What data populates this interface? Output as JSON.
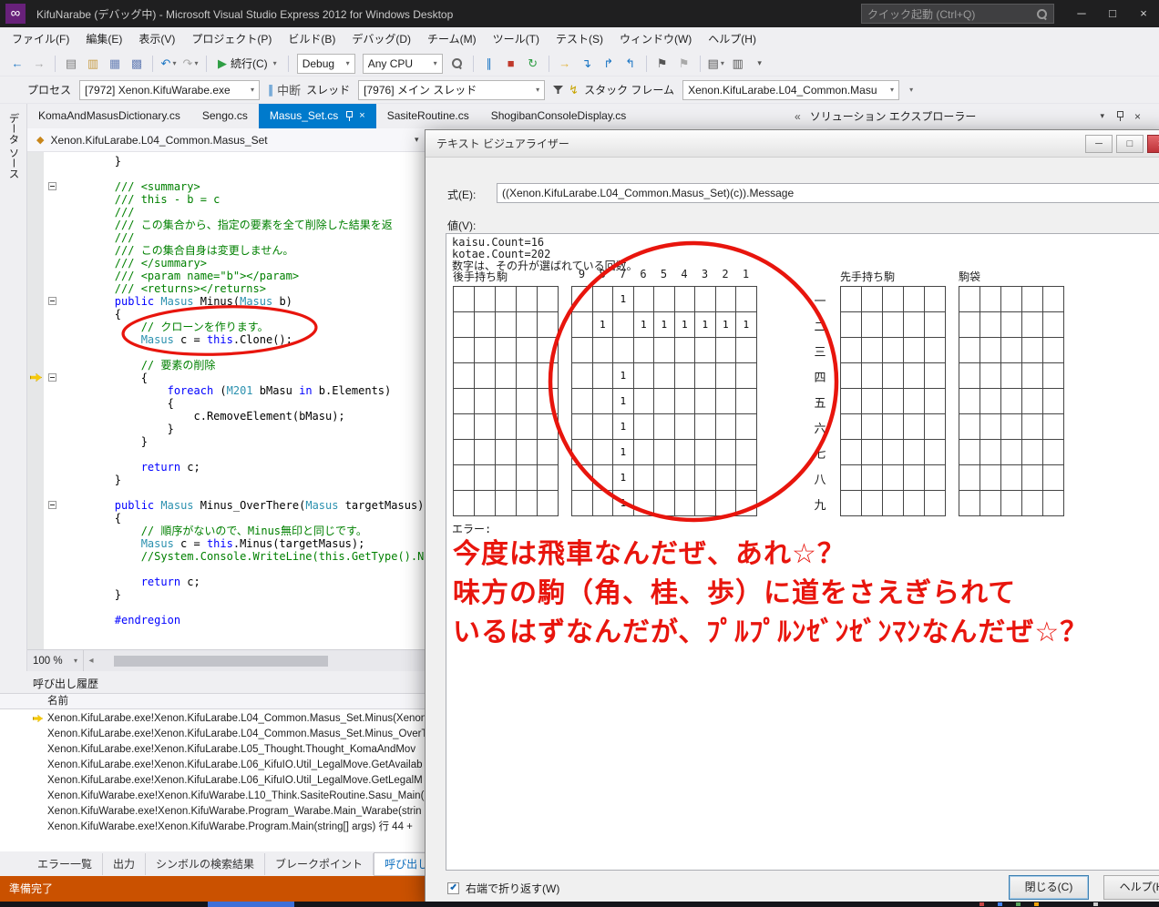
{
  "window": {
    "title": "KifuNarabe (デバッグ中) - Microsoft Visual Studio Express 2012 for Windows Desktop",
    "quick_launch": "クイック起動 (Ctrl+Q)",
    "buttons": [
      {
        "name": "minimize-button",
        "glyph": "─"
      },
      {
        "name": "maximize-button",
        "glyph": "□"
      },
      {
        "name": "close-button",
        "glyph": "×"
      }
    ]
  },
  "icons": {
    "dropdown": "▾",
    "close": "×",
    "chevrons_left": "«",
    "scroll_left": "◂",
    "breadcrumb_class": "◆",
    "stack_frame": "↯",
    "break_all": "∥"
  },
  "menu": {
    "items": [
      "ファイル(F)",
      "編集(E)",
      "表示(V)",
      "プロジェクト(P)",
      "ビルド(B)",
      "デバッグ(D)",
      "チーム(M)",
      "ツール(T)",
      "テスト(S)",
      "ウィンドウ(W)",
      "ヘルプ(H)"
    ]
  },
  "toolbar": {
    "items": [
      {
        "t": "icon",
        "name": "navigate-back-icon",
        "g": "←",
        "c": "#1c76c4"
      },
      {
        "t": "icon",
        "name": "navigate-forward-icon",
        "g": "→",
        "c": "#a9a9a9"
      },
      {
        "t": "sep"
      },
      {
        "t": "icon",
        "name": "new-file-icon",
        "g": "▤",
        "c": "#7d7d7d"
      },
      {
        "t": "icon",
        "name": "open-file-icon",
        "g": "▥",
        "c": "#c79d46"
      },
      {
        "t": "icon",
        "name": "save-icon",
        "g": "▦",
        "c": "#6b83b7"
      },
      {
        "t": "icon",
        "name": "save-all-icon",
        "g": "▩",
        "c": "#6b83b7"
      },
      {
        "t": "sep"
      },
      {
        "t": "icon",
        "name": "undo-icon",
        "g": "↶",
        "c": "#1c76c4",
        "dd": true
      },
      {
        "t": "icon",
        "name": "redo-icon",
        "g": "↷",
        "c": "#a9a9a9",
        "dd": true
      },
      {
        "t": "sep"
      },
      {
        "t": "continue",
        "name": "continue-button",
        "g": "▶",
        "c": "#2f9e44",
        "label": "続行(C)",
        "dd": true
      },
      {
        "t": "sep"
      },
      {
        "t": "combo",
        "name": "solution-configurations-combo",
        "v": "Debug",
        "w": 64
      },
      {
        "t": "combo",
        "name": "solution-platforms-combo",
        "v": "Any CPU",
        "w": 88
      },
      {
        "t": "magnifier",
        "name": "find-icon"
      },
      {
        "t": "sep"
      },
      {
        "t": "icon",
        "name": "break-all-icon",
        "g": "∥",
        "c": "#1c76c4"
      },
      {
        "t": "icon",
        "name": "stop-debugging-icon",
        "g": "■",
        "c": "#c0392b"
      },
      {
        "t": "icon",
        "name": "restart-icon",
        "g": "↻",
        "c": "#2f9e44"
      },
      {
        "t": "sep"
      },
      {
        "t": "icon",
        "name": "show-next-statement-icon",
        "g": "→",
        "c": "#e0b23a"
      },
      {
        "t": "icon",
        "name": "step-into-icon",
        "g": "↴",
        "c": "#1c76c4"
      },
      {
        "t": "icon",
        "name": "step-over-icon",
        "g": "↱",
        "c": "#1c76c4"
      },
      {
        "t": "icon",
        "name": "step-out-icon",
        "g": "↰",
        "c": "#1c76c4"
      },
      {
        "t": "sep"
      },
      {
        "t": "icon",
        "name": "bookmark-icon",
        "g": "⚑",
        "c": "#555555"
      },
      {
        "t": "icon",
        "name": "bookmark-next-icon",
        "g": "⚑",
        "c": "#a9a9a9"
      },
      {
        "t": "sep"
      },
      {
        "t": "icon",
        "name": "output-window-icon",
        "g": "▤",
        "c": "#555555",
        "dd": true
      },
      {
        "t": "icon",
        "name": "immediate-window-icon",
        "g": "▥",
        "c": "#555555"
      },
      {
        "t": "dd",
        "name": "toolbar-options-icon"
      }
    ]
  },
  "debug_bar": {
    "process_label": "プロセス",
    "process_value": "[7972] Xenon.KifuWarabe.exe",
    "break_label": "中断",
    "thread_label": "スレッド",
    "thread_value": "[7976] メイン スレッド",
    "stack_frame_label": "スタック フレーム",
    "stack_frame_value": "Xenon.KifuLarabe.L04_Common.Masu"
  },
  "doc_tabs": [
    {
      "label": "KomaAndMasusDictionary.cs",
      "active": false
    },
    {
      "label": "Sengo.cs",
      "active": false
    },
    {
      "label": "Masus_Set.cs",
      "active": true
    },
    {
      "label": "SasiteRoutine.cs",
      "active": false
    },
    {
      "label": "ShogibanConsoleDisplay.cs",
      "active": false
    }
  ],
  "solution_explorer": {
    "collapse_icon": "«",
    "title": "ソリューション エクスプローラー"
  },
  "data_sources_tab": "データ ソース",
  "editor": {
    "breadcrumb": "Xenon.KifuLarabe.L04_Common.Masus_Set",
    "zoom": "100 %",
    "lines": [
      {
        "s": [
          [
            "pl",
            "        }"
          ]
        ]
      },
      {
        "s": []
      },
      {
        "s": [
          [
            "cm",
            "        /// <summary>"
          ]
        ],
        "fold": true
      },
      {
        "s": [
          [
            "cm",
            "        /// this - b = c"
          ]
        ]
      },
      {
        "s": [
          [
            "cm",
            "        ///"
          ]
        ]
      },
      {
        "s": [
          [
            "cm",
            "        /// この集合から、指定の要素を全て削除した結果を返"
          ]
        ]
      },
      {
        "s": [
          [
            "cm",
            "        ///"
          ]
        ]
      },
      {
        "s": [
          [
            "cm",
            "        /// この集合自身は変更しません。"
          ]
        ]
      },
      {
        "s": [
          [
            "cm",
            "        /// </summary>"
          ]
        ]
      },
      {
        "s": [
          [
            "cm",
            "        /// <param name=\"b\"></param>"
          ]
        ]
      },
      {
        "s": [
          [
            "cm",
            "        /// <returns></returns>"
          ]
        ]
      },
      {
        "s": [
          [
            "pl",
            "        "
          ],
          [
            "kw",
            "public"
          ],
          [
            "pl",
            " "
          ],
          [
            "ty",
            "Masus"
          ],
          [
            "pl",
            " Minus("
          ],
          [
            "ty",
            "Masus"
          ],
          [
            "pl",
            " b)"
          ]
        ],
        "fold": true
      },
      {
        "s": [
          [
            "pl",
            "        {"
          ]
        ]
      },
      {
        "s": [
          [
            "cm",
            "            // クローンを作ります。"
          ]
        ]
      },
      {
        "s": [
          [
            "pl",
            "            "
          ],
          [
            "ty",
            "Masus"
          ],
          [
            "pl",
            " c = "
          ],
          [
            "kw",
            "this"
          ],
          [
            "pl",
            ".Clone();"
          ]
        ]
      },
      {
        "s": []
      },
      {
        "s": [
          [
            "cm",
            "            // 要素の削除"
          ]
        ]
      },
      {
        "s": [
          [
            "pl",
            "            {"
          ]
        ],
        "fold": true,
        "arrow": true
      },
      {
        "s": [
          [
            "pl",
            "                "
          ],
          [
            "kw",
            "foreach"
          ],
          [
            "pl",
            " ("
          ],
          [
            "ty",
            "M201"
          ],
          [
            "pl",
            " bMasu "
          ],
          [
            "kw",
            "in"
          ],
          [
            "pl",
            " b.Elements)"
          ]
        ]
      },
      {
        "s": [
          [
            "pl",
            "                {"
          ]
        ]
      },
      {
        "s": [
          [
            "pl",
            "                    c.RemoveElement(bMasu);"
          ]
        ]
      },
      {
        "s": [
          [
            "pl",
            "                }"
          ]
        ]
      },
      {
        "s": [
          [
            "pl",
            "            }"
          ]
        ]
      },
      {
        "s": []
      },
      {
        "s": [
          [
            "pl",
            "            "
          ],
          [
            "kw",
            "return"
          ],
          [
            "pl",
            " c;"
          ]
        ]
      },
      {
        "s": [
          [
            "pl",
            "        }"
          ]
        ]
      },
      {
        "s": []
      },
      {
        "s": [
          [
            "pl",
            "        "
          ],
          [
            "kw",
            "public"
          ],
          [
            "pl",
            " "
          ],
          [
            "ty",
            "Masus"
          ],
          [
            "pl",
            " Minus_OverThere("
          ],
          [
            "ty",
            "Masus"
          ],
          [
            "pl",
            " targetMasus)"
          ]
        ],
        "fold": true
      },
      {
        "s": [
          [
            "pl",
            "        {"
          ]
        ]
      },
      {
        "s": [
          [
            "cm",
            "            // 順序がないので、Minus無印と同じです。"
          ]
        ]
      },
      {
        "s": [
          [
            "pl",
            "            "
          ],
          [
            "ty",
            "Masus"
          ],
          [
            "pl",
            " c = "
          ],
          [
            "kw",
            "this"
          ],
          [
            "pl",
            ".Minus(targetMasus);"
          ]
        ]
      },
      {
        "s": [
          [
            "cm",
            "            //System.Console.WriteLine(this.GetType().Nam"
          ]
        ]
      },
      {
        "s": []
      },
      {
        "s": [
          [
            "pl",
            "            "
          ],
          [
            "kw",
            "return"
          ],
          [
            "pl",
            " c;"
          ]
        ]
      },
      {
        "s": [
          [
            "pl",
            "        }"
          ]
        ]
      },
      {
        "s": []
      },
      {
        "s": [
          [
            "kw",
            "        #endregion"
          ]
        ]
      }
    ]
  },
  "call_stack": {
    "title": "呼び出し履歴",
    "column": "名前",
    "current_index": 0,
    "rows": [
      "Xenon.KifuLarabe.exe!Xenon.KifuLarabe.L04_Common.Masus_Set.Minus(Xenon",
      "Xenon.KifuLarabe.exe!Xenon.KifuLarabe.L04_Common.Masus_Set.Minus_OverT",
      "Xenon.KifuLarabe.exe!Xenon.KifuLarabe.L05_Thought.Thought_KomaAndMov",
      "Xenon.KifuLarabe.exe!Xenon.KifuLarabe.L06_KifuIO.Util_LegalMove.GetAvailab",
      "Xenon.KifuLarabe.exe!Xenon.KifuLarabe.L06_KifuIO.Util_LegalMove.GetLegalM",
      "Xenon.KifuWarabe.exe!Xenon.KifuWarabe.L10_Think.SasiteRoutine.Sasu_Main(",
      "Xenon.KifuWarabe.exe!Xenon.KifuWarabe.Program_Warabe.Main_Warabe(strin",
      "Xenon.KifuWarabe.exe!Xenon.KifuWarabe.Program.Main(string[] args) 行 44 +"
    ]
  },
  "bottom_tabs": [
    {
      "label": "エラー一覧",
      "active": false
    },
    {
      "label": "出力",
      "active": false
    },
    {
      "label": "シンボルの検索結果",
      "active": false
    },
    {
      "label": "ブレークポイント",
      "active": false
    },
    {
      "label": "呼び出し履歴",
      "active": true
    }
  ],
  "status": {
    "text": "準備完了",
    "color": "#CA5100"
  },
  "visualizer": {
    "title": "テキスト ビジュアライザー",
    "expression_label": "式(E):",
    "expression": "((Xenon.KifuLarabe.L04_Common.Masus_Set)(c)).Message",
    "value_label": "値(V):",
    "header_lines": [
      "kaisu.Count=16",
      "kotae.Count=202",
      "数字は、その升が選ばれている回数。"
    ],
    "gote_hand_label": "後手持ち駒",
    "sente_hand_label": "先手持ち駒",
    "piece_bag_label": "駒袋",
    "file_numbers": [
      "9",
      "8",
      "7",
      "6",
      "5",
      "4",
      "3",
      "2",
      "1"
    ],
    "rank_labels": [
      "一",
      "二",
      "三",
      "四",
      "五",
      "六",
      "七",
      "八",
      "九"
    ],
    "board": [
      [
        "",
        "",
        "1",
        "",
        "",
        "",
        "",
        "",
        ""
      ],
      [
        "",
        "1",
        "",
        "1",
        "1",
        "1",
        "1",
        "1",
        "1"
      ],
      [
        "",
        "",
        "",
        "",
        "",
        "",
        "",
        "",
        ""
      ],
      [
        "",
        "",
        "1",
        "",
        "",
        "",
        "",
        "",
        ""
      ],
      [
        "",
        "",
        "1",
        "",
        "",
        "",
        "",
        "",
        ""
      ],
      [
        "",
        "",
        "1",
        "",
        "",
        "",
        "",
        "",
        ""
      ],
      [
        "",
        "",
        "1",
        "",
        "",
        "",
        "",
        "",
        ""
      ],
      [
        "",
        "",
        "1",
        "",
        "",
        "",
        "",
        "",
        ""
      ],
      [
        "",
        "",
        "1",
        "",
        "",
        "",
        "",
        "",
        ""
      ]
    ],
    "error_label": "エラー:",
    "wrap_label": "右端で折り返す(W)",
    "wrap_checked": true,
    "close_label": "閉じる(C)",
    "help_label": "ヘルプ(H)"
  },
  "annotations": {
    "color": "#e8150d",
    "texts": [
      "今度は飛車なんだぜ、あれ☆？",
      "味方の駒（角、桂、歩）に道をさえぎられて",
      "いるはずなんだが、ﾌﾟﾙﾌﾟﾙﾝｾﾞﾝｾﾞﾝﾏﾝなんだぜ☆？"
    ]
  }
}
